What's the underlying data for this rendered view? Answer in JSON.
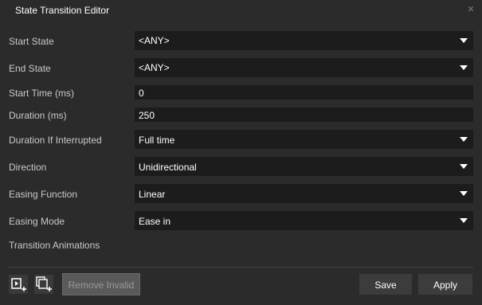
{
  "window": {
    "title": "State Transition Editor"
  },
  "fields": [
    {
      "label": "Start State",
      "value": "<ANY>",
      "type": "dropdown"
    },
    {
      "label": "End State",
      "value": "<ANY>",
      "type": "dropdown"
    },
    {
      "label": "Start Time (ms)",
      "value": "0",
      "type": "text"
    },
    {
      "label": "Duration (ms)",
      "value": "250",
      "type": "text"
    },
    {
      "label": "Duration If Interrupted",
      "value": "Full time",
      "type": "dropdown"
    },
    {
      "label": "Direction",
      "value": "Unidirectional",
      "type": "dropdown"
    },
    {
      "label": "Easing Function",
      "value": "Linear",
      "type": "dropdown"
    },
    {
      "label": "Easing Mode",
      "value": "Ease in",
      "type": "dropdown"
    }
  ],
  "section": {
    "transition_animations_label": "Transition Animations"
  },
  "footer": {
    "add_animation_icon": "play-add-icon",
    "add_group_icon": "copy-add-icon",
    "remove_invalid_label": "Remove Invalid",
    "save_label": "Save",
    "apply_label": "Apply"
  },
  "colors": {
    "background": "#2b2b2b",
    "field_bg": "#1c1c1c",
    "button_bg": "#3c3c3c"
  }
}
